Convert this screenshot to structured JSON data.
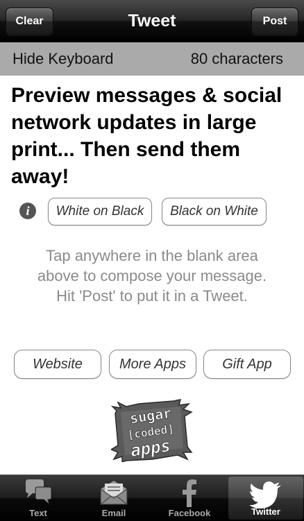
{
  "navbar": {
    "title": "Tweet",
    "left_button": "Clear",
    "right_button": "Post"
  },
  "keyboard_bar": {
    "hide_label": "Hide Keyboard",
    "char_count": "80 characters"
  },
  "preview_text": "Preview messages & social network updates in large print... Then send them away!",
  "display_options": {
    "white_on_black": "White on Black",
    "black_on_white": "Black on White"
  },
  "hint": {
    "line1": "Tap anywhere in the blank area",
    "line2": "above to compose your message.",
    "line3": "Hit 'Post' to put it in a Tweet."
  },
  "links": {
    "website": "Website",
    "more_apps": "More Apps",
    "gift_app": "Gift App"
  },
  "logo": {
    "line1": "sugar",
    "line2": "[coded]",
    "line3": "apps"
  },
  "tabs": [
    {
      "label": "Text",
      "icon": "chat-bubbles-icon",
      "active": false
    },
    {
      "label": "Email",
      "icon": "envelope-icon",
      "active": false
    },
    {
      "label": "Facebook",
      "icon": "facebook-icon",
      "active": false
    },
    {
      "label": "Twitter",
      "icon": "twitter-bird-icon",
      "active": true
    }
  ]
}
